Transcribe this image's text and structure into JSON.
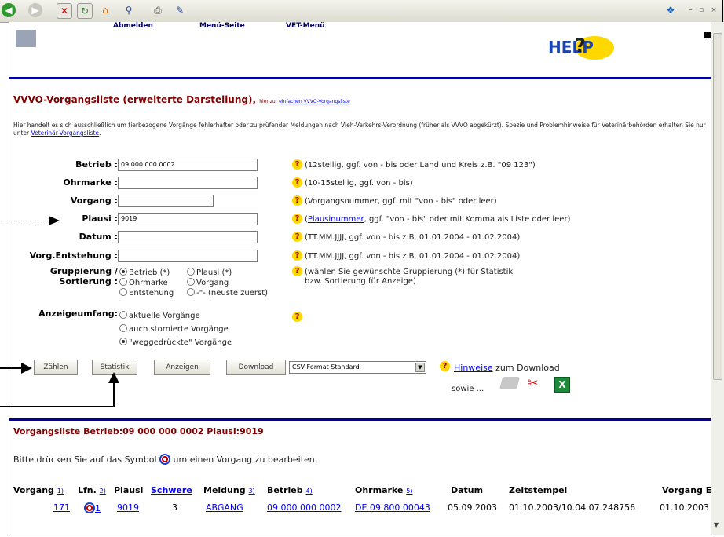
{
  "header": {
    "menu": [
      "Abmelden",
      "Menü-Seite",
      "VET-Menü"
    ],
    "help": "HELP"
  },
  "page": {
    "title": "VVVO-Vorgangsliste (erweiterte Darstellung)",
    "title_suffix_prefix": "hier zur",
    "title_suffix_link": "einfachen VVVO-Vorgangsliste",
    "info_text": "Hier handelt es sich ausschließlich um tierbezogene Vorgänge fehlerhafter oder zu prüfender Meldungen nach Vieh-Verkehrs-Verordnung (früher als VVVO abgekürzt). Spezie und Problemhinweise für Veterinärbehörden erhalten Sie nur unter",
    "info_link": "Veterinär-Vorgangsliste"
  },
  "form": {
    "betrieb_label": "Betrieb :",
    "betrieb_value": "09 000 000 0002",
    "betrieb_hint": "(12stellig, ggf. von - bis oder Land und Kreis z.B. \"09 123\")",
    "ohrmarke_label": "Ohrmarke :",
    "ohrmarke_hint": "(10-15stellig, ggf. von - bis)",
    "vorgang_label": "Vorgang :",
    "vorgang_hint": "(Vorgangsnummer, ggf. mit \"von - bis\" oder leer)",
    "plausi_label": "Plausi :",
    "plausi_value": "9019",
    "plausi_hint_link": "Plausinummer",
    "plausi_hint": ", ggf. \"von - bis\" oder mit Komma als Liste oder leer)",
    "datum_label": "Datum :",
    "datum_hint": "(TT.MM.JJJJ, ggf. von - bis z.B. 01.01.2004 - 01.02.2004)",
    "entstehung_label": "Vorg.Entstehung :",
    "entstehung_hint": "(TT.MM.JJJJ, ggf. von - bis z.B. 01.01.2004 - 01.02.2004)",
    "gruppierung_label": "Gruppierung /",
    "sortierung_label": "Sortierung :",
    "grp_opt1": "Betrieb (*)",
    "grp_opt2": "Plausi (*)",
    "sort_opt1": "Ohrmarke",
    "sort_opt2": "Vorgang",
    "sort_opt3": "Entstehung",
    "sort_opt4": "-\"- (neuste zuerst)",
    "grp_hint_1": "(wählen Sie gewünschte Gruppierung (*) für Statistik",
    "grp_hint_2": "bzw. Sortierung für Anzeige)",
    "anzeige_label": "Anzeigeumfang:",
    "anz_opt1": "aktuelle Vorgänge",
    "anz_opt2": "auch stornierte Vorgänge",
    "anz_opt3": "\"weggedrückte\" Vorgänge"
  },
  "buttons": {
    "zaehlen": "Zählen",
    "statistik": "Statistik",
    "anzeigen": "Anzeigen",
    "download": "Download",
    "format_selected": "CSV-Format Standard"
  },
  "download_hint": {
    "link": "Hinweise",
    "text": "zum Download",
    "sowie": "sowie ..."
  },
  "result": {
    "title": "Vorgangsliste Betrieb:09 000 000 0002 Plausi:9019",
    "instruction_prefix": "Bitte drücken Sie auf das Symbol",
    "instruction_suffix": "um einen Vorgang zu bearbeiten.",
    "columns": {
      "vorgang": "Vorgang",
      "vorgang_sort": "1)",
      "lfn": "Lfn.",
      "lfn_sort": "2)",
      "plausi": "Plausi",
      "schwere": "Schwere",
      "meldung": "Meldung",
      "meldung_sort": "3)",
      "betrieb": "Betrieb",
      "betrieb_sort": "4)",
      "ohrmarke": "Ohrmarke",
      "ohrmarke_sort": "5)",
      "datum": "Datum",
      "zeitstempel": "Zeitstempel",
      "vorgang_e": "Vorgang E"
    },
    "row": {
      "vorgang": "171",
      "lfn": "1",
      "plausi": "9019",
      "schwere": "3",
      "meldung": "ABGANG",
      "betrieb": "09 000 000 0002",
      "ohrmarke": "DE 09 800 00043",
      "datum": "05.09.2003",
      "zeitstempel": "01.10.2003/10.04.07.248756",
      "vorgang_e": "01.10.2003"
    }
  }
}
